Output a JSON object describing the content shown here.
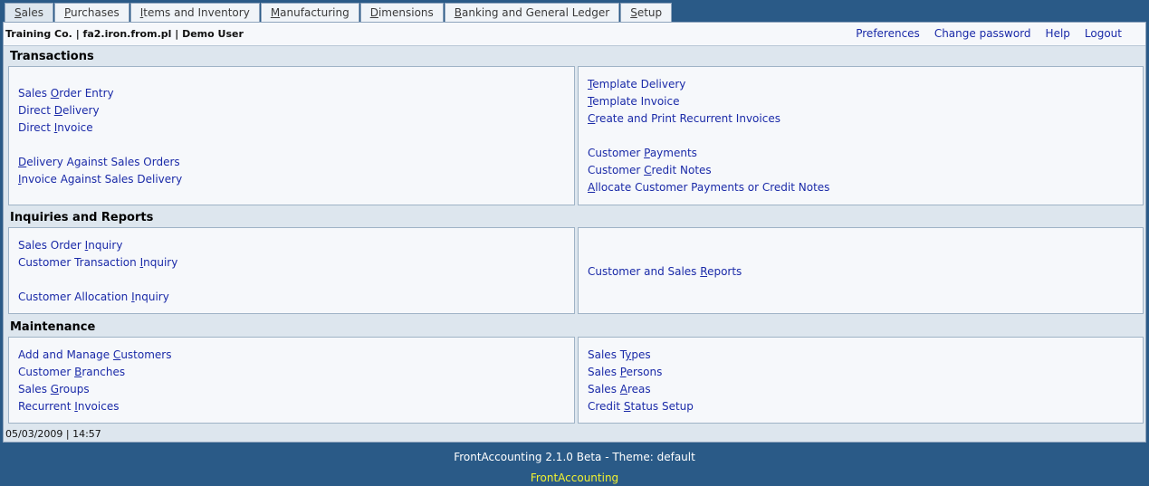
{
  "tabs": [
    {
      "pre": "",
      "u": "S",
      "post": "ales",
      "active": true
    },
    {
      "pre": "",
      "u": "P",
      "post": "urchases"
    },
    {
      "pre": "",
      "u": "I",
      "post": "tems and Inventory"
    },
    {
      "pre": "",
      "u": "M",
      "post": "anufacturing"
    },
    {
      "pre": "",
      "u": "D",
      "post": "imensions"
    },
    {
      "pre": "",
      "u": "B",
      "post": "anking and General Ledger"
    },
    {
      "pre": "",
      "u": "S",
      "post": "etup"
    }
  ],
  "header": {
    "company": "Training Co. | fa2.iron.from.pl | Demo User",
    "links": [
      "Preferences",
      "Change password",
      "Help",
      "Logout"
    ]
  },
  "sections": {
    "transactions": {
      "title": "Transactions",
      "left": [
        {
          "pre": "Sales ",
          "u": "O",
          "post": "rder Entry"
        },
        {
          "pre": "Direct ",
          "u": "D",
          "post": "elivery"
        },
        {
          "pre": "Direct ",
          "u": "I",
          "post": "nvoice"
        },
        {
          "pre": "",
          "u": "D",
          "post": "elivery Against Sales Orders"
        },
        {
          "pre": "",
          "u": "I",
          "post": "nvoice Against Sales Delivery"
        }
      ],
      "right": [
        {
          "pre": "",
          "u": "T",
          "post": "emplate Delivery"
        },
        {
          "pre": "",
          "u": "T",
          "post": "emplate Invoice"
        },
        {
          "pre": "",
          "u": "C",
          "post": "reate and Print Recurrent Invoices"
        },
        {
          "pre": "Customer ",
          "u": "P",
          "post": "ayments"
        },
        {
          "pre": "Customer ",
          "u": "C",
          "post": "redit Notes"
        },
        {
          "pre": "",
          "u": "A",
          "post": "llocate Customer Payments or Credit Notes"
        }
      ]
    },
    "inquiries": {
      "title": "Inquiries and Reports",
      "left": [
        {
          "pre": "Sales Order ",
          "u": "I",
          "post": "nquiry"
        },
        {
          "pre": "Customer Transaction ",
          "u": "I",
          "post": "nquiry"
        },
        {
          "pre": "Customer Allocation ",
          "u": "I",
          "post": "nquiry"
        }
      ],
      "right": [
        {
          "pre": "Customer and Sales ",
          "u": "R",
          "post": "eports"
        }
      ]
    },
    "maintenance": {
      "title": "Maintenance",
      "left": [
        {
          "pre": "Add and Manage ",
          "u": "C",
          "post": "ustomers"
        },
        {
          "pre": "Customer ",
          "u": "B",
          "post": "ranches"
        },
        {
          "pre": "Sales ",
          "u": "G",
          "post": "roups"
        },
        {
          "pre": "Recurrent ",
          "u": "I",
          "post": "nvoices"
        }
      ],
      "right": [
        {
          "pre": "Sales T",
          "u": "y",
          "post": "pes"
        },
        {
          "pre": "Sales ",
          "u": "P",
          "post": "ersons"
        },
        {
          "pre": "Sales ",
          "u": "A",
          "post": "reas"
        },
        {
          "pre": "Credit ",
          "u": "S",
          "post": "tatus Setup"
        }
      ]
    }
  },
  "status": {
    "datetime": "05/03/2009 | 14:57"
  },
  "footer": {
    "version": "FrontAccounting 2.1.0 Beta - Theme: default",
    "brand": "FrontAccounting"
  }
}
